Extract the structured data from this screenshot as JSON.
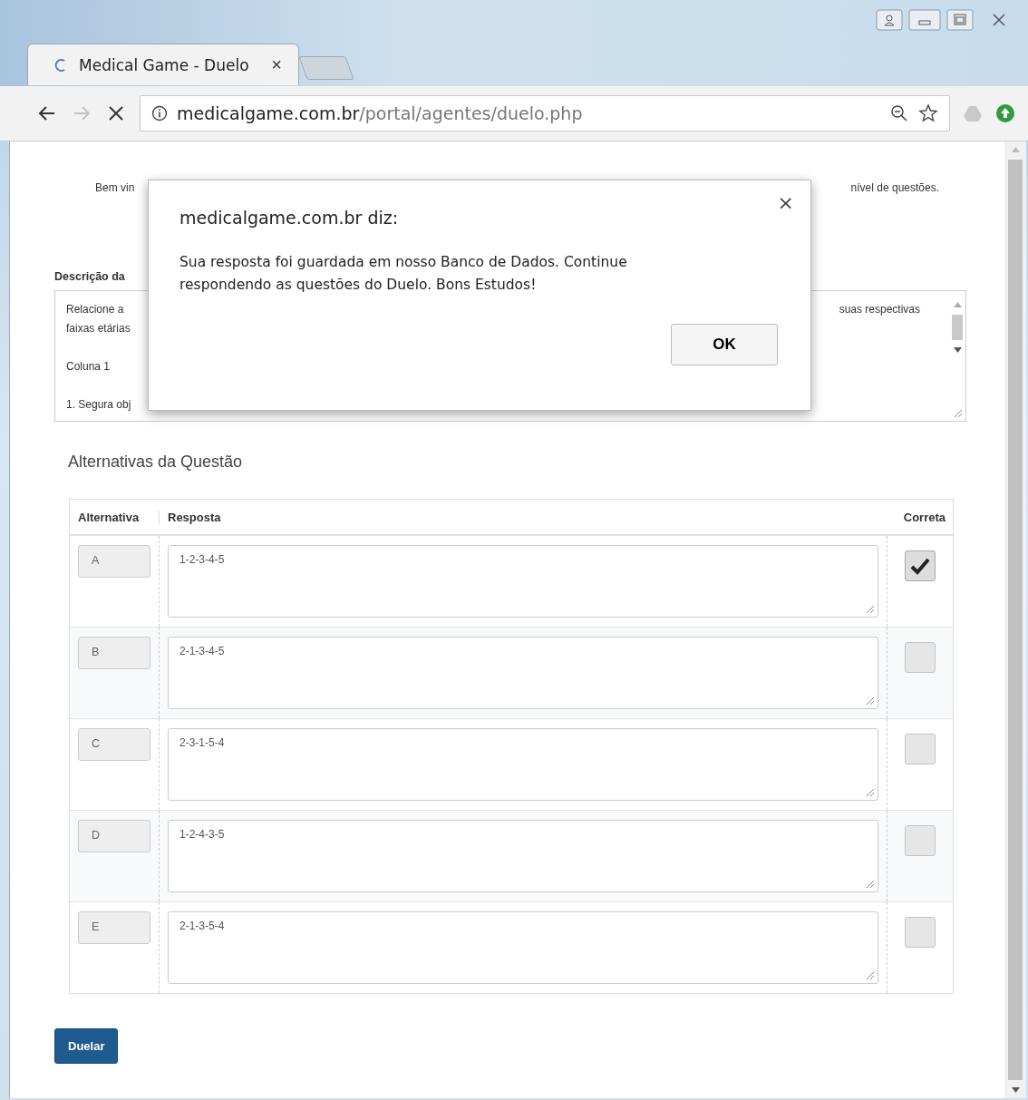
{
  "browser": {
    "tab_title": "Medical Game - Duelo",
    "tab_close": "×",
    "url_domain": "medicalgame.com.br",
    "url_path": "/portal/agentes/duelo.php"
  },
  "page": {
    "intro_left": "Bem vin",
    "intro_right": "nível de questões.",
    "description_label": "Descrição da",
    "description": [
      {
        "left": "Relacione a",
        "right": "suas respectivas"
      },
      {
        "left": "faixas etárias"
      },
      {
        "left": "Coluna 1",
        "gap_before": true
      },
      {
        "left": "1. Segura obj",
        "gap_before": true
      }
    ],
    "alternatives_title": "Alternativas da Questão",
    "columns": [
      "Alternativa",
      "Resposta",
      "Correta"
    ],
    "rows": [
      {
        "letter": "A",
        "answer": "1-2-3-4-5",
        "correct": true
      },
      {
        "letter": "B",
        "answer": "2-1-3-4-5",
        "correct": false
      },
      {
        "letter": "C",
        "answer": "2-3-1-5-4",
        "correct": false
      },
      {
        "letter": "D",
        "answer": "1-2-4-3-5",
        "correct": false
      },
      {
        "letter": "E",
        "answer": "2-1-3-5-4",
        "correct": false
      }
    ],
    "submit": "Duelar"
  },
  "dialog": {
    "title": "medicalgame.com.br diz:",
    "close": "×",
    "message": "Sua resposta foi guardada em nosso Banco de Dados. Continue respondendo as questões do Duelo. Bons Estudos!",
    "ok": "OK"
  }
}
